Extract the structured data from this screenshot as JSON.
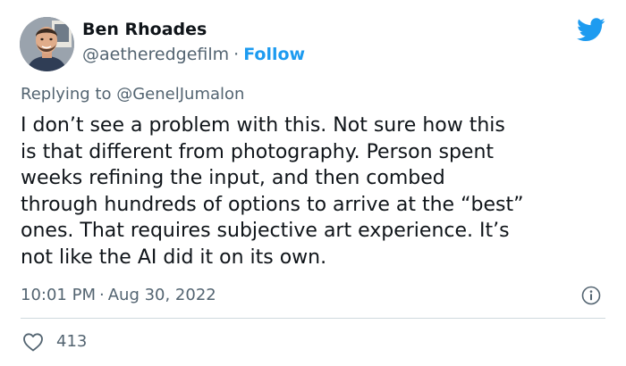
{
  "author": {
    "name": "Ben Rhoades",
    "handle": "@aetheredgefilm",
    "separator": "·",
    "follow_label": "Follow"
  },
  "reply": {
    "prefix": "Replying to",
    "mention": "@GenelJumalon"
  },
  "tweet": {
    "text": "I don’t see a problem with this. Not sure how this\nis that different from photography. Person spent\nweeks refining the input, and then combed\nthrough hundreds of options to arrive at the “best”\nones. That requires subjective art experience. It’s\nnot like the AI did it on its own."
  },
  "meta": {
    "time": "10:01 PM",
    "separator": "·",
    "date": "Aug 30, 2022"
  },
  "engagement": {
    "likes": "413"
  },
  "icons": {
    "brand": "twitter-bird-icon",
    "info": "info-icon",
    "like": "heart-icon"
  },
  "colors": {
    "accent": "#1d9bf0",
    "text": "#0f1419",
    "secondary": "#536471",
    "divider": "#cfd9de"
  }
}
